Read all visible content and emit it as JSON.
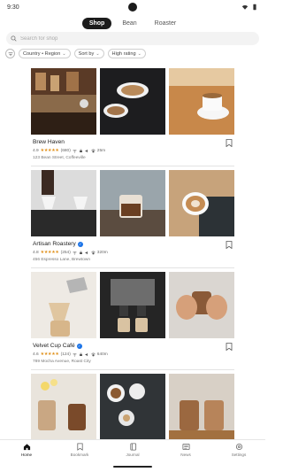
{
  "status": {
    "time": "9:30"
  },
  "tabs": [
    {
      "label": "Shop",
      "active": true
    },
    {
      "label": "Bean",
      "active": false
    },
    {
      "label": "Roaster",
      "active": false
    }
  ],
  "search": {
    "placeholder": "Search for shop"
  },
  "filters": [
    {
      "label": "Country • Region"
    },
    {
      "label": "Sort by"
    },
    {
      "label": "High rating"
    }
  ],
  "shops": [
    {
      "name": "Brew Haven",
      "rating": "4.9",
      "reviews": "(680)",
      "distance": "25m",
      "address": "123 Bean Street, Coffeeville",
      "photos": [
        "coffee-bar-interior",
        "latte-art-cup",
        "cup-on-wooden-table"
      ]
    },
    {
      "name": "Artisan Roastery",
      "rating": "4.8",
      "reviews": "(254)",
      "distance": "320m",
      "address": "456 Espresso Lane, Brewtown",
      "photos": [
        "pour-over-drippers",
        "coffee-glass",
        "latte-art-on-laptop"
      ]
    },
    {
      "name": "Velvet Cup Café",
      "rating": "4.6",
      "reviews": "(124)",
      "distance": "640m",
      "address": "789 Mocha Avenue, Roast City",
      "photos": [
        "pour-over-kettle",
        "espresso-machine",
        "hands-holding-cup"
      ]
    },
    {
      "name": "",
      "rating": "",
      "reviews": "",
      "distance": "",
      "address": "",
      "photos": [
        "iced-coffee-flowers",
        "cups-and-cookies",
        "iced-coffee-glasses"
      ]
    }
  ],
  "nav": [
    {
      "label": "Home",
      "icon": "home-icon",
      "active": true
    },
    {
      "label": "Bookmark",
      "icon": "bookmark-icon",
      "active": false
    },
    {
      "label": "Journal",
      "icon": "journal-icon",
      "active": false
    },
    {
      "label": "News",
      "icon": "news-icon",
      "active": false
    },
    {
      "label": "Settings",
      "icon": "settings-icon",
      "active": false
    }
  ],
  "colors": {
    "accent": "#1c1c1c",
    "star": "#e0901a",
    "verified": "#1a73e8"
  }
}
